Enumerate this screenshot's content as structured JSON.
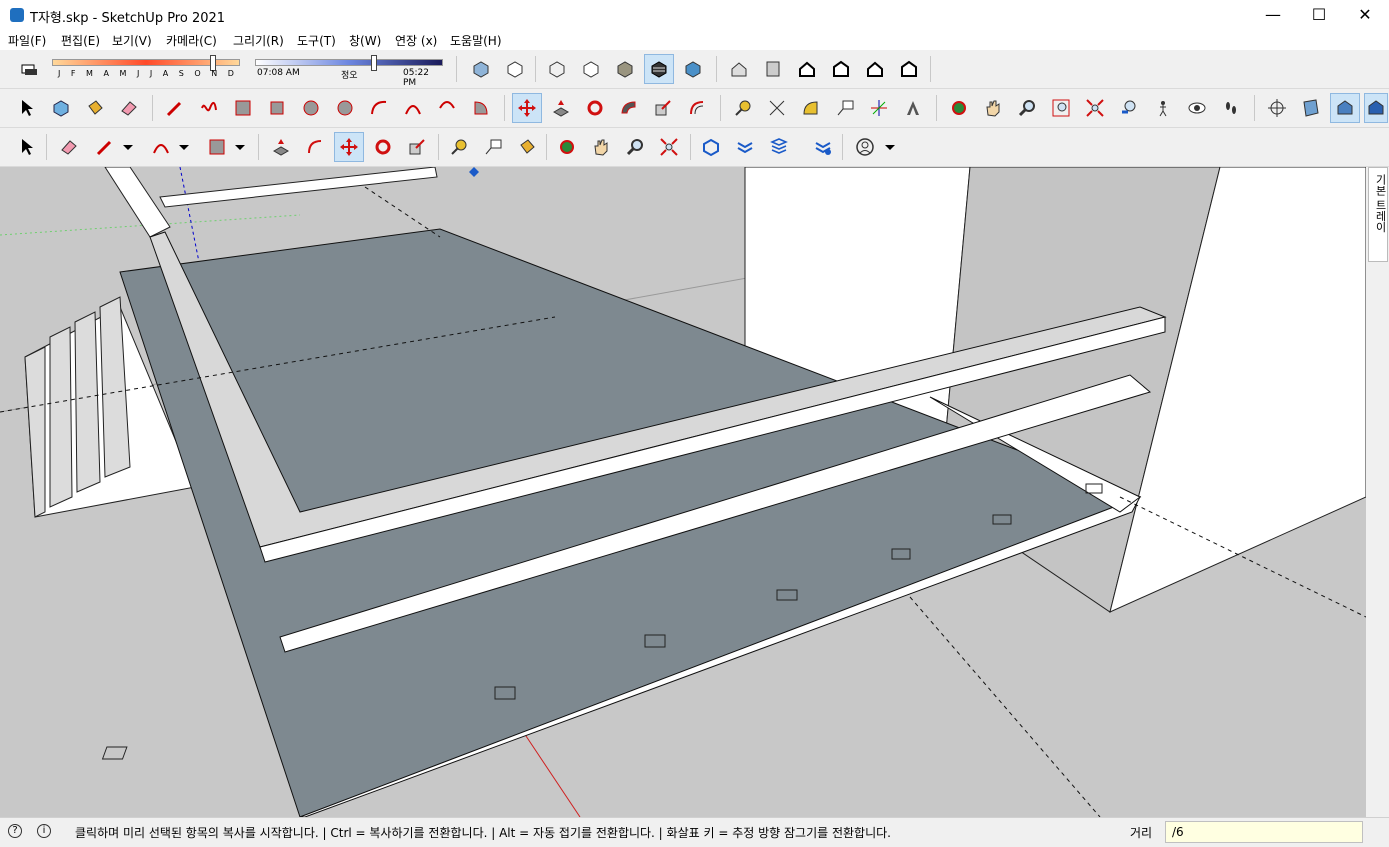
{
  "window": {
    "title": "T자형.skp - SketchUp Pro 2021",
    "minimize": "—",
    "maximize": "☐",
    "close": "✕"
  },
  "menu": [
    {
      "label": "파일(F)"
    },
    {
      "label": "편집(E)"
    },
    {
      "label": "보기(V)"
    },
    {
      "label": "카메라(C)"
    },
    {
      "label": "그리기(R)"
    },
    {
      "label": "도구(T)"
    },
    {
      "label": "창(W)"
    },
    {
      "label": "연장 (x)"
    },
    {
      "label": "도움말(H)"
    }
  ],
  "shadow": {
    "months": "J F M A M J J A S O N D",
    "time_start": "07:08 AM",
    "time_mid": "정오",
    "time_end": "05:22 PM"
  },
  "viewport": {
    "colors": {
      "sky": "#c8c8c8",
      "slab": "#7e8990",
      "white": "#ffffff",
      "wall": "#c4c4c4"
    }
  },
  "tray": {
    "tab_label": "기본 트레이"
  },
  "status": {
    "message": "클릭하며 미리 선택된 항목의 복사를 시작합니다. | Ctrl = 복사하기를 전환합니다. | Alt = 자동 접기를 전환합니다. | 화살표 키 = 추정 방향 잠그기를 전환합니다.",
    "vcb_label": "거리",
    "vcb_value": "/6"
  }
}
